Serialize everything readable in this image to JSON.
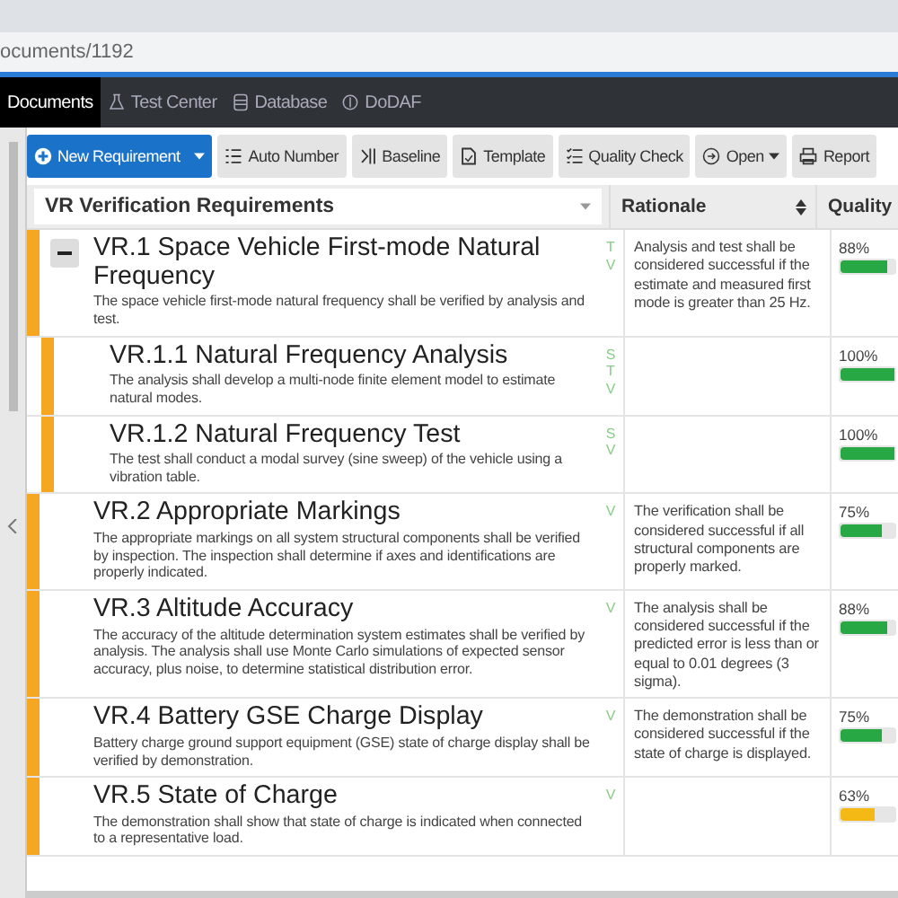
{
  "address_bar": {
    "url": "ocuments/1192"
  },
  "nav": [
    {
      "label": "Documents",
      "selected": true
    },
    {
      "label": "Test Center",
      "selected": false
    },
    {
      "label": "Database",
      "selected": false
    },
    {
      "label": "DoDAF",
      "selected": false
    }
  ],
  "toolbar": [
    {
      "label": "New Requirement",
      "kind": "primary"
    },
    {
      "label": "Auto Number",
      "kind": "plain"
    },
    {
      "label": "Baseline",
      "kind": "plain"
    },
    {
      "label": "Template",
      "kind": "plain"
    },
    {
      "label": "Quality Check",
      "kind": "plain"
    },
    {
      "label": "Open",
      "kind": "dropdown"
    },
    {
      "label": "Report",
      "kind": "plain"
    }
  ],
  "table": {
    "columns": [
      {
        "label": "VR Verification Requirements",
        "kind": "select"
      },
      {
        "label": "Rationale",
        "kind": "sort"
      },
      {
        "label": "Quality",
        "kind": "plain"
      }
    ],
    "rows": [
      {
        "title": "VR.1 Space Vehicle First-mode Natural Frequency",
        "description": "The space vehicle first-mode natural frequency shall be verified by analysis and test.",
        "methods": [
          "T",
          "V"
        ],
        "rationale": "Analysis and test shall be considered successful if the estimate and measured first mode is greater than 25 Hz.",
        "quality": "88%",
        "level": 0.88,
        "color": "#28a745",
        "expanded": true,
        "children": [
          {
            "title": "VR.1.1 Natural Frequency Analysis",
            "description": "The analysis shall develop a multi-node finite element model to estimate natural modes.",
            "methods": [
              "S",
              "T",
              "V"
            ],
            "quality": "100%",
            "level": 1,
            "color": "#28a745"
          },
          {
            "title": "VR.1.2 Natural Frequency Test",
            "description": "The test shall conduct a modal survey (sine sweep) of the vehicle using a vibration table.",
            "methods": [
              "S",
              "V"
            ],
            "quality": "100%",
            "level": 1,
            "color": "#28a745"
          }
        ]
      },
      {
        "title": "VR.2 Appropriate Markings",
        "description": "The appropriate markings on all system structural components shall be verified by inspection. The inspection shall determine if axes and identifications are properly indicated.",
        "methods": [
          "V"
        ],
        "rationale": "The verification shall be considered successful if all structural components are properly marked.",
        "quality": "75%",
        "level": 0.75,
        "color": "#28a745"
      },
      {
        "title": "VR.3 Altitude Accuracy",
        "description": "The accuracy of the altitude determination system estimates shall be verified by analysis. The analysis shall use Monte Carlo simulations of expected sensor accuracy, plus noise, to determine statistical distribution error.",
        "methods": [
          "V"
        ],
        "rationale": "The analysis shall be considered successful if the predicted error is less than or equal to 0.01 degrees (3 sigma).",
        "quality": "88%",
        "level": 0.88,
        "color": "#28a745"
      },
      {
        "title": "VR.4 Battery GSE Charge Display",
        "description": "Battery charge ground support equipment (GSE) state of charge display shall be verified by demonstration.",
        "methods": [
          "V"
        ],
        "rationale": "The demonstration shall be considered successful if the state of charge is displayed.",
        "quality": "75%",
        "level": 0.75,
        "color": "#28a745"
      },
      {
        "title": "VR.5 State of Charge",
        "description": "The demonstration shall show that state of charge is indicated when connected to a representative load.",
        "methods": [
          "V"
        ],
        "quality": "63%",
        "level": 0.63,
        "color": "#f5b915"
      }
    ]
  }
}
